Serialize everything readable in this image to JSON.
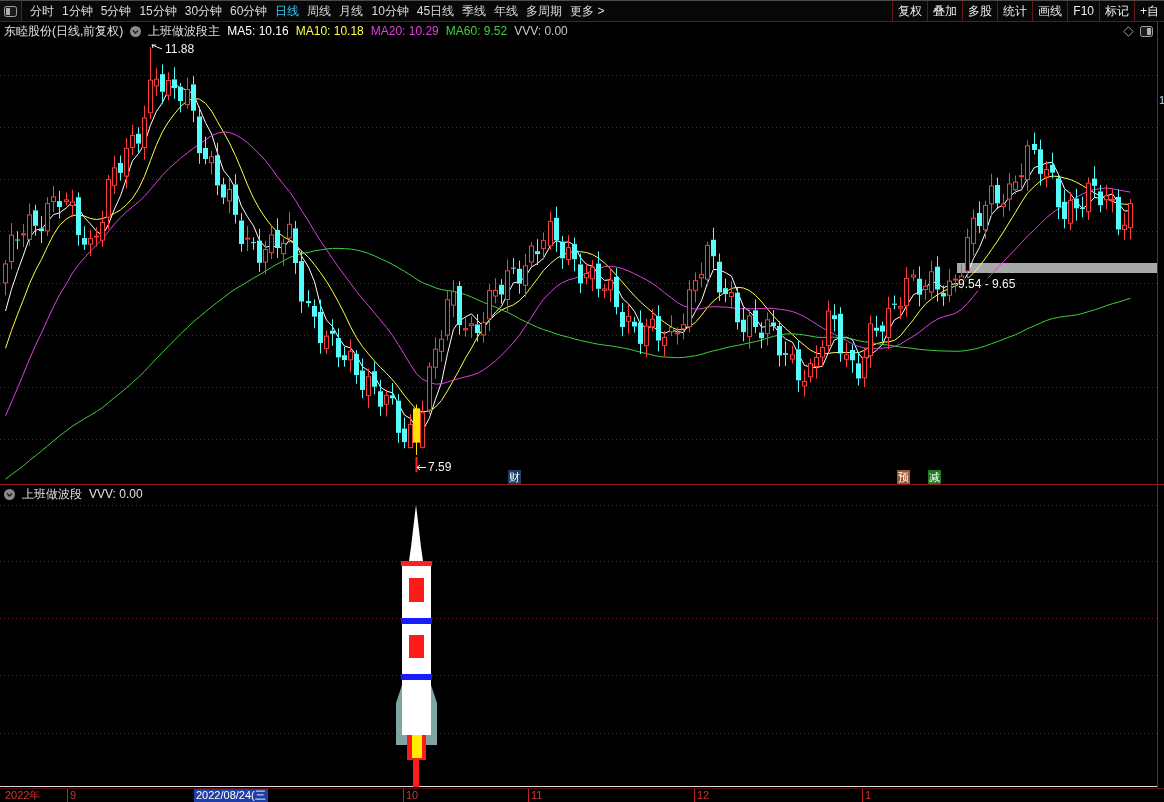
{
  "toolbar": {
    "periods": [
      {
        "label": "分时",
        "selected": false
      },
      {
        "label": "1分钟",
        "selected": false
      },
      {
        "label": "5分钟",
        "selected": false
      },
      {
        "label": "15分钟",
        "selected": false
      },
      {
        "label": "30分钟",
        "selected": false
      },
      {
        "label": "60分钟",
        "selected": false
      },
      {
        "label": "日线",
        "selected": true
      },
      {
        "label": "周线",
        "selected": false
      },
      {
        "label": "月线",
        "selected": false
      },
      {
        "label": "10分钟",
        "selected": false
      },
      {
        "label": "45日线",
        "selected": false
      },
      {
        "label": "季线",
        "selected": false
      },
      {
        "label": "年线",
        "selected": false
      },
      {
        "label": "多周期",
        "selected": false
      }
    ],
    "more_menu": "更多 >",
    "tools": [
      "复权",
      "叠加",
      "多股",
      "统计",
      "画线",
      "F10",
      "标记",
      "+自"
    ]
  },
  "main_chart": {
    "title": "东睦股份(日线,前复权)",
    "indicator": "上班做波段主",
    "legend": [
      {
        "label": "MA5: 10.16",
        "color": "#ffffff"
      },
      {
        "label": "MA10: 10.18",
        "color": "#ffff40"
      },
      {
        "label": "MA20: 10.29",
        "color": "#e040e0"
      },
      {
        "label": "MA60: 9.52",
        "color": "#40d040"
      },
      {
        "label": "VVV: 0.00",
        "color": "#c8c8c8"
      }
    ],
    "high_label": "11.88",
    "low_label": "7.59",
    "band_label": "9.54 - 9.65",
    "event_badges": [
      {
        "text": "财",
        "color": "#1e3f66"
      },
      {
        "text": "预",
        "color": "#a0522d"
      },
      {
        "text": "减",
        "color": "#1e7a1e"
      }
    ],
    "price_axis_label": "1"
  },
  "sub_chart": {
    "indicator": "上班做波段",
    "legend": "VVV: 0.00"
  },
  "time_axis": [
    {
      "text": "2022年",
      "kind": "year"
    },
    {
      "text": "9",
      "kind": "month"
    },
    {
      "text": "2022/08/24(三",
      "kind": "cursor"
    },
    {
      "text": "10",
      "kind": "month"
    },
    {
      "text": "11",
      "kind": "month"
    },
    {
      "text": "12",
      "kind": "month"
    },
    {
      "text": "1",
      "kind": "month"
    }
  ]
}
